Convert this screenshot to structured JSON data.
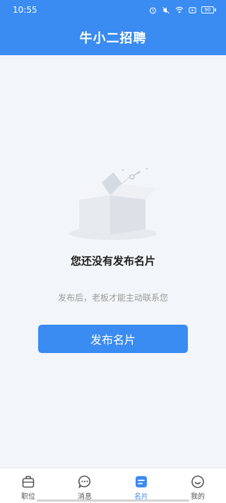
{
  "status_bar": {
    "time": "10:55",
    "battery": "90"
  },
  "header": {
    "title": "牛小二招聘"
  },
  "empty_state": {
    "title": "您还没有发布名片",
    "subtitle": "发布后，老板才能主动联系您",
    "button_label": "发布名片"
  },
  "tabs": [
    {
      "label": "职位",
      "icon": "briefcase-icon",
      "active": false
    },
    {
      "label": "消息",
      "icon": "chat-bubble-icon",
      "active": false
    },
    {
      "label": "名片",
      "icon": "card-icon",
      "active": true
    },
    {
      "label": "我的",
      "icon": "smiley-icon",
      "active": false
    }
  ],
  "colors": {
    "primary": "#3a8bf2",
    "background": "#f2f5f9",
    "inactive_tab": "#555555"
  }
}
